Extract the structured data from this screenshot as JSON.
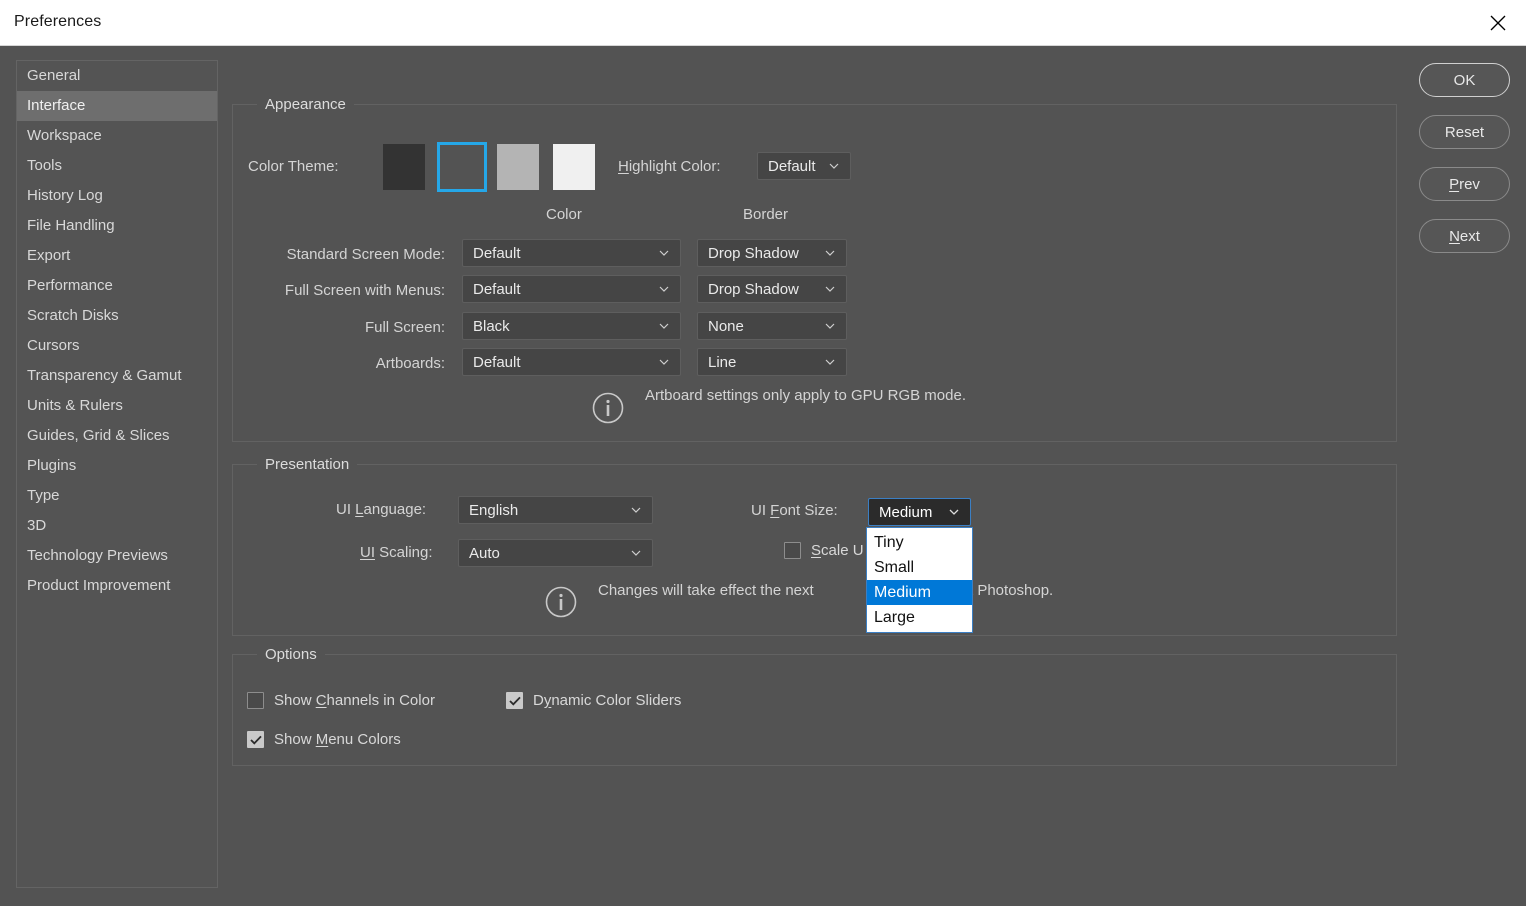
{
  "window": {
    "title": "Preferences",
    "close_icon": "close-icon"
  },
  "sidebar": {
    "items": [
      {
        "label": "General",
        "selected": false
      },
      {
        "label": "Interface",
        "selected": true
      },
      {
        "label": "Workspace",
        "selected": false
      },
      {
        "label": "Tools",
        "selected": false
      },
      {
        "label": "History Log",
        "selected": false
      },
      {
        "label": "File Handling",
        "selected": false
      },
      {
        "label": "Export",
        "selected": false
      },
      {
        "label": "Performance",
        "selected": false
      },
      {
        "label": "Scratch Disks",
        "selected": false
      },
      {
        "label": "Cursors",
        "selected": false
      },
      {
        "label": "Transparency & Gamut",
        "selected": false
      },
      {
        "label": "Units & Rulers",
        "selected": false
      },
      {
        "label": "Guides, Grid & Slices",
        "selected": false
      },
      {
        "label": "Plugins",
        "selected": false
      },
      {
        "label": "Type",
        "selected": false
      },
      {
        "label": "3D",
        "selected": false
      },
      {
        "label": "Technology Previews",
        "selected": false
      },
      {
        "label": "Product Improvement",
        "selected": false
      }
    ]
  },
  "appearance": {
    "group_label": "Appearance",
    "color_theme_label": "Color Theme:",
    "swatches": [
      {
        "name": "theme-swatch-darkest",
        "color": "#333333",
        "selected": false
      },
      {
        "name": "theme-swatch-dark",
        "color": "#535353",
        "selected": true
      },
      {
        "name": "theme-swatch-light",
        "color": "#b4b4b4",
        "selected": false
      },
      {
        "name": "theme-swatch-lightest",
        "color": "#f0f0f0",
        "selected": false
      }
    ],
    "selection_color": "#25a7e8",
    "highlight_color_label": "Highlight Color:",
    "highlight_color_value": "Default",
    "col_header_color": "Color",
    "col_header_border": "Border",
    "rows": [
      {
        "label": "Standard Screen Mode:",
        "color": "Default",
        "border": "Drop Shadow"
      },
      {
        "label": "Full Screen with Menus:",
        "color": "Default",
        "border": "Drop Shadow"
      },
      {
        "label": "Full Screen:",
        "color": "Black",
        "border": "None"
      },
      {
        "label": "Artboards:",
        "color": "Default",
        "border": "Line"
      }
    ],
    "note": "Artboard settings only apply to GPU RGB mode.",
    "note_icon": "info-icon"
  },
  "presentation": {
    "group_label": "Presentation",
    "ui_language_label": "UI Language:",
    "ui_language_value": "English",
    "ui_scaling_label": "UI Scaling:",
    "ui_scaling_value": "Auto",
    "ui_font_size_label": "UI Font Size:",
    "ui_font_size_value": "Medium",
    "ui_font_size_options": [
      "Tiny",
      "Small",
      "Medium",
      "Large"
    ],
    "ui_font_size_selected": "Medium",
    "dropdown_highlight_color": "#0078d7",
    "scale_ui_label": "Scale U",
    "scale_ui_checked": false,
    "note": "Changes will take effect the next",
    "note_tail": "t Photoshop.",
    "note_icon": "info-icon"
  },
  "options": {
    "group_label": "Options",
    "items": [
      {
        "label_pre": "Show ",
        "accel": "C",
        "label_post": "hannels in Color",
        "checked": false,
        "name": "show-channels-in-color"
      },
      {
        "label_pre": "D",
        "accel": "y",
        "label_post": "namic Color Sliders",
        "checked": true,
        "name": "dynamic-color-sliders"
      },
      {
        "label_pre": "Show ",
        "accel": "M",
        "label_post": "enu Colors",
        "checked": true,
        "name": "show-menu-colors"
      }
    ]
  },
  "buttons": [
    {
      "label": "OK",
      "name": "ok-button",
      "primary": true
    },
    {
      "label": "Reset",
      "name": "reset-button",
      "primary": false
    },
    {
      "label": "Prev",
      "name": "prev-button",
      "primary": false
    },
    {
      "label": "Next",
      "name": "next-button",
      "primary": false
    }
  ]
}
